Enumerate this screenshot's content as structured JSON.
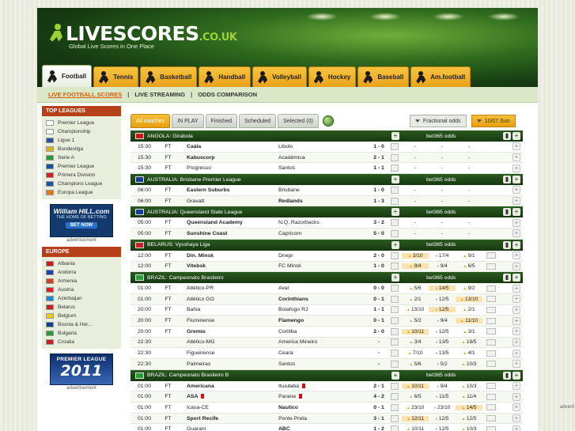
{
  "site": {
    "logo_main": "LIVESCORES",
    "logo_domain": ".CO.UK",
    "tagline": "Global Live Scores in One Place"
  },
  "sports_tabs": [
    {
      "label": "Football",
      "active": true
    },
    {
      "label": "Tennis"
    },
    {
      "label": "Basketball"
    },
    {
      "label": "Handball"
    },
    {
      "label": "Volleyball"
    },
    {
      "label": "Hockey"
    },
    {
      "label": "Baseball"
    },
    {
      "label": "Am.football"
    }
  ],
  "subnav": [
    "LIVE FOOTBALL SCORES",
    "LIVE STREAMING",
    "ODDS COMPARISON"
  ],
  "sidebar": {
    "top_title": "TOP LEAGUES",
    "top_leagues": [
      {
        "label": "Premier League",
        "color": "#ffffff"
      },
      {
        "label": "Championship",
        "color": "#ffffff"
      },
      {
        "label": "Ligue 1",
        "color": "#2b4ea0"
      },
      {
        "label": "Bundesliga",
        "color": "#d8b020"
      },
      {
        "label": "Serie A",
        "color": "#2a9a3a"
      },
      {
        "label": "Premier League",
        "color": "#1a4fa0"
      },
      {
        "label": "Primera Division",
        "color": "#d02020"
      },
      {
        "label": "Champions League",
        "color": "#2050a0"
      },
      {
        "label": "Europa League",
        "color": "#e07a10"
      }
    ],
    "ad1": {
      "line1": "William HILL.com",
      "line2": "THE HOME OF BETTING",
      "btn": "BET NOW",
      "caption": "advertisement"
    },
    "europe_title": "EUROPE",
    "europe": [
      {
        "label": "Albania",
        "color": "#d01818"
      },
      {
        "label": "Andorra",
        "color": "#2040b0"
      },
      {
        "label": "Armenia",
        "color": "#d04020"
      },
      {
        "label": "Austria",
        "color": "#e02020"
      },
      {
        "label": "Azerbaijan",
        "color": "#1a8ac8"
      },
      {
        "label": "Belarus",
        "color": "#c82020"
      },
      {
        "label": "Belgium",
        "color": "#e8c818"
      },
      {
        "label": "Bosnia & Her...",
        "color": "#1a3a9a"
      },
      {
        "label": "Bulgaria",
        "color": "#2a9a3a"
      },
      {
        "label": "Croatia",
        "color": "#c82020"
      }
    ],
    "ad2": {
      "line1": "PREMIER LEAGUE",
      "line2": "2011",
      "caption": "advertisement"
    }
  },
  "filters": {
    "tabs": [
      {
        "label": "All matches",
        "active": true
      },
      {
        "label": "IN PLAY"
      },
      {
        "label": "Finished"
      },
      {
        "label": "Scheduled"
      },
      {
        "label": "Selected (0)"
      }
    ],
    "odds_format": "Fractional odds",
    "date": "10/07 Sun"
  },
  "leagues": [
    {
      "country": "ANGOLA",
      "name": "Girabola",
      "flag": "#c81818",
      "odds_label": "bet365 odds",
      "matches": [
        {
          "time": "15:30",
          "status": "FT",
          "home": "Caála",
          "away": "Libolo",
          "score": "1 - 0",
          "hb": true,
          "ab": false,
          "o": [
            "-",
            "-",
            "-"
          ],
          "hl": -1
        },
        {
          "time": "15:30",
          "status": "FT",
          "home": "Kabuscorp",
          "away": "Académica",
          "score": "2 - 1",
          "hb": true,
          "ab": false,
          "o": [
            "-",
            "-",
            "-"
          ],
          "hl": -1
        },
        {
          "time": "15:30",
          "status": "FT",
          "home": "Progresso",
          "away": "Santos",
          "score": "1 - 1",
          "hb": false,
          "ab": false,
          "o": [
            "-",
            "-",
            "-"
          ],
          "hl": -1
        }
      ]
    },
    {
      "country": "AUSTRALIA",
      "name": "Brisbane Premier League",
      "flag": "#1a3a9a",
      "odds_label": "bet365 odds",
      "matches": [
        {
          "time": "06:00",
          "status": "FT",
          "home": "Eastern Suburbs",
          "away": "Brisbane",
          "score": "1 - 0",
          "hb": true,
          "ab": false,
          "o": [
            "-",
            "-",
            "-"
          ],
          "hl": -1
        },
        {
          "time": "06:00",
          "status": "FT",
          "home": "Gravatt",
          "away": "Redlands",
          "score": "1 - 3",
          "hb": false,
          "ab": true,
          "o": [
            "-",
            "-",
            "-"
          ],
          "hl": -1
        }
      ]
    },
    {
      "country": "AUSTRALIA",
      "name": "Queensland State League",
      "flag": "#1a3a9a",
      "odds_label": "bet365 odds",
      "matches": [
        {
          "time": "05:00",
          "status": "FT",
          "home": "Queensland Academy",
          "away": "N.Q. Razorbacks",
          "score": "3 - 2",
          "hb": true,
          "ab": false,
          "o": [
            "-",
            "-",
            "-"
          ],
          "hl": -1
        },
        {
          "time": "05:00",
          "status": "FT",
          "home": "Sunshine Coast",
          "away": "Capricorn",
          "score": "5 - 0",
          "hb": true,
          "ab": false,
          "o": [
            "-",
            "-",
            "-"
          ],
          "hl": -1
        }
      ]
    },
    {
      "country": "BELARUS",
      "name": "Vysshaya Liga",
      "flag": "#c82020",
      "odds_label": "bet365 odds",
      "matches": [
        {
          "time": "12:00",
          "status": "FT",
          "home": "Din. Minsk",
          "away": "Dnepr",
          "score": "2 - 0",
          "hb": true,
          "ab": false,
          "o": [
            "3/10",
            "17/4",
            "9/1"
          ],
          "hl": 0
        },
        {
          "time": "12:00",
          "status": "FT",
          "home": "Vitebsk",
          "away": "FC Minsk",
          "score": "1 - 0",
          "hb": true,
          "ab": false,
          "o": [
            "9/4",
            "9/4",
            "6/5"
          ],
          "hl": 0
        }
      ]
    },
    {
      "country": "BRAZIL",
      "name": "Campeonato Brasileiro",
      "flag": "#2a9a3a",
      "odds_label": "bet365 odds",
      "matches": [
        {
          "time": "01:00",
          "status": "FT",
          "home": "Atlético-PR",
          "away": "Avaí",
          "score": "0 - 0",
          "hb": false,
          "ab": false,
          "o": [
            "5/6",
            "14/5",
            "9/2"
          ],
          "hl": 1
        },
        {
          "time": "01:00",
          "status": "FT",
          "home": "Atlético GO",
          "away": "Corinthians",
          "score": "0 - 1",
          "hb": false,
          "ab": true,
          "o": [
            "2/1",
            "12/5",
            "13/10"
          ],
          "hl": 2
        },
        {
          "time": "20:00",
          "status": "FT",
          "home": "Bahia",
          "away": "Botafogo RJ",
          "score": "1 - 1",
          "hb": false,
          "ab": false,
          "o": [
            "13/10",
            "12/5",
            "2/1"
          ],
          "hl": 1
        },
        {
          "time": "20:00",
          "status": "FT",
          "home": "Fluminense",
          "away": "Flamengo",
          "score": "0 - 1",
          "hb": false,
          "ab": true,
          "o": [
            "5/2",
            "9/4",
            "11/10"
          ],
          "hl": 2
        },
        {
          "time": "20:00",
          "status": "FT",
          "home": "Gremio",
          "away": "Coritiba",
          "score": "2 - 0",
          "hb": true,
          "ab": false,
          "o": [
            "10/11",
            "12/5",
            "3/1"
          ],
          "hl": 0
        },
        {
          "time": "22:30",
          "status": "",
          "home": "Atlético-MG",
          "away": "America Mineiro",
          "score": "-",
          "hb": false,
          "ab": false,
          "o": [
            "3/4",
            "13/5",
            "18/5"
          ],
          "hl": -1
        },
        {
          "time": "22:30",
          "status": "",
          "home": "Figueirense",
          "away": "Ceara",
          "score": "-",
          "hb": false,
          "ab": false,
          "o": [
            "7/10",
            "13/5",
            "4/1"
          ],
          "hl": -1
        },
        {
          "time": "22:30",
          "status": "",
          "home": "Palmeiras",
          "away": "Santos",
          "score": "-",
          "hb": false,
          "ab": false,
          "o": [
            "5/6",
            "5/2",
            "10/3"
          ],
          "hl": -1
        }
      ]
    },
    {
      "country": "BRAZIL",
      "name": "Campeonato Brasileiro B",
      "flag": "#2a9a3a",
      "odds_label": "bet365 odds",
      "matches": [
        {
          "time": "01:00",
          "status": "FT",
          "home": "Americana",
          "away": "Ituiutaba",
          "score": "2 - 1",
          "hb": true,
          "ab": false,
          "hr": false,
          "ar": true,
          "o": [
            "10/11",
            "9/4",
            "10/3"
          ],
          "hl": 0
        },
        {
          "time": "01:00",
          "status": "FT",
          "home": "ASA",
          "away": "Parana",
          "score": "4 - 2",
          "hb": true,
          "ab": false,
          "hr": true,
          "ar": true,
          "o": [
            "6/5",
            "11/5",
            "11/4"
          ],
          "hl": -1
        },
        {
          "time": "01:00",
          "status": "FT",
          "home": "Icasa-CE",
          "away": "Nautico",
          "score": "0 - 1",
          "hb": false,
          "ab": true,
          "o": [
            "23/10",
            "23/10",
            "14/5"
          ],
          "hl": 2
        },
        {
          "time": "01:00",
          "status": "FT",
          "home": "Sport Recife",
          "away": "Ponte Preta",
          "score": "3 - 1",
          "hb": true,
          "ab": false,
          "o": [
            "12/11",
            "12/5",
            "12/5"
          ],
          "hl": 0
        },
        {
          "time": "01:00",
          "status": "FT",
          "home": "Guarani",
          "away": "ABC",
          "score": "1 - 2",
          "hb": false,
          "ab": true,
          "o": [
            "10/11",
            "12/5",
            "10/3"
          ],
          "hl": -1
        }
      ]
    }
  ],
  "right_caption": "adverti"
}
